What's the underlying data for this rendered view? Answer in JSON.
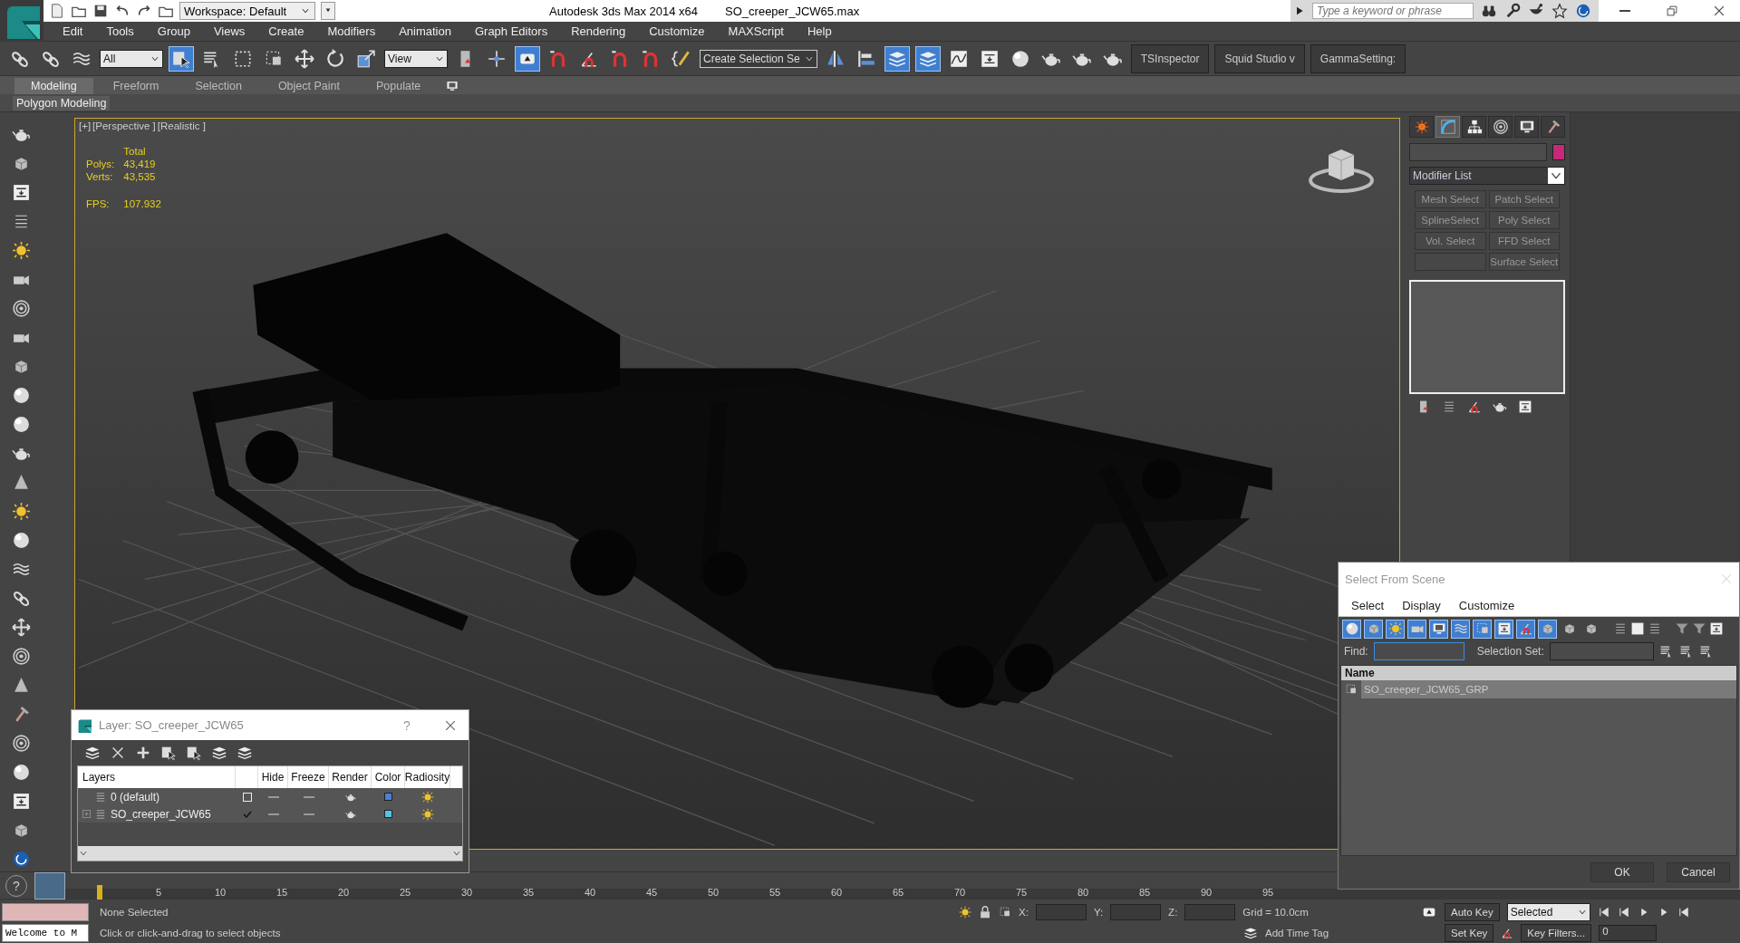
{
  "title_bar": {
    "workspace": "Workspace: Default",
    "app_title": "Autodesk 3ds Max  2014 x64",
    "file_name": "SO_creeper_JCW65.max",
    "search_placeholder": "Type a keyword or phrase"
  },
  "menu": [
    "Edit",
    "Tools",
    "Group",
    "Views",
    "Create",
    "Modifiers",
    "Animation",
    "Graph Editors",
    "Rendering",
    "Customize",
    "MAXScript",
    "Help"
  ],
  "main_toolbar": [
    {
      "kind": "icon",
      "on": false
    },
    {
      "kind": "icon",
      "on": false
    },
    {
      "kind": "icon",
      "on": false
    },
    {
      "kind": "dropdown",
      "value": "All"
    },
    {
      "kind": "icon",
      "on": true
    },
    {
      "kind": "icon",
      "on": false
    },
    {
      "kind": "icon",
      "on": false
    },
    {
      "kind": "icon",
      "on": false
    },
    {
      "kind": "icon",
      "on": false
    },
    {
      "kind": "icon",
      "on": false
    },
    {
      "kind": "icon",
      "on": false
    },
    {
      "kind": "dropdown",
      "value": "View"
    },
    {
      "kind": "icon",
      "on": false
    },
    {
      "kind": "icon",
      "on": false
    },
    {
      "kind": "icon",
      "on": true
    },
    {
      "kind": "icon",
      "on": false
    },
    {
      "kind": "icon",
      "on": false
    },
    {
      "kind": "icon",
      "on": false
    },
    {
      "kind": "icon",
      "on": false
    },
    {
      "kind": "icon",
      "on": false
    },
    {
      "kind": "dropdown",
      "value": "Create Selection Se"
    },
    {
      "kind": "icon",
      "on": false
    },
    {
      "kind": "icon",
      "on": false
    },
    {
      "kind": "icon",
      "on": true
    },
    {
      "kind": "icon",
      "on": true
    },
    {
      "kind": "icon",
      "on": false
    },
    {
      "kind": "icon",
      "on": false
    },
    {
      "kind": "icon",
      "on": false
    },
    {
      "kind": "icon",
      "on": false
    },
    {
      "kind": "icon",
      "on": false
    },
    {
      "kind": "icon",
      "on": false
    },
    {
      "kind": "text",
      "value": "TSInspector"
    },
    {
      "kind": "text",
      "value": "Squid Studio v"
    },
    {
      "kind": "text",
      "value": "GammaSetting:"
    }
  ],
  "ribbon_tabs": [
    {
      "label": "Modeling",
      "selected": true
    },
    {
      "label": "Freeform",
      "selected": false
    },
    {
      "label": "Selection",
      "selected": false
    },
    {
      "label": "Object Paint",
      "selected": false
    },
    {
      "label": "Populate",
      "selected": false
    }
  ],
  "ribbon_panel": "Polygon Modeling",
  "viewport": {
    "labels": [
      "[+]",
      "[Perspective ]",
      "[Realistic ]"
    ],
    "stats_header": "Total",
    "stats": [
      {
        "label": "Polys:",
        "value": "43,419"
      },
      {
        "label": "Verts:",
        "value": "43,535"
      }
    ],
    "fps_label": "FPS:",
    "fps": "107.932"
  },
  "command_panel": {
    "tabs": [
      {
        "selected": false
      },
      {
        "selected": true
      },
      {
        "selected": false
      },
      {
        "selected": false
      },
      {
        "selected": false
      },
      {
        "selected": false
      }
    ],
    "modifier_list": "Modifier List",
    "modifier_buttons": [
      {
        "kind": "button",
        "label": "Mesh Select"
      },
      {
        "kind": "button",
        "label": "Patch Select"
      },
      {
        "kind": "button",
        "label": "SplineSelect"
      },
      {
        "kind": "button",
        "label": "Poly Select"
      },
      {
        "kind": "button",
        "label": "Vol. Select"
      },
      {
        "kind": "button",
        "label": "FFD Select"
      },
      {
        "kind": "blank"
      },
      {
        "kind": "button",
        "label": "Surface Select"
      }
    ]
  },
  "select_from_scene": {
    "title": "Select From Scene",
    "menus": [
      "Select",
      "Display",
      "Customize"
    ],
    "filters": [
      {
        "on": true
      },
      {
        "on": true
      },
      {
        "on": true
      },
      {
        "on": true
      },
      {
        "on": true
      },
      {
        "on": true
      },
      {
        "on": true
      },
      {
        "on": true
      },
      {
        "on": true
      },
      {
        "on": true
      },
      {
        "on": false
      },
      {
        "on": false
      }
    ],
    "find_label": "Find:",
    "selection_set_label": "Selection Set:",
    "column": "Name",
    "rows": [
      {
        "name": "SO_creeper_JCW65_GRP",
        "selected": true
      }
    ],
    "buttons": [
      "OK",
      "Cancel"
    ]
  },
  "layer_dialog": {
    "title": "Layer: SO_creeper_JCW65",
    "help": "?",
    "columns": [
      "Layers",
      "Hide",
      "Freeze",
      "Render",
      "Color",
      "Radiosity"
    ],
    "rows": [
      {
        "name": "0 (default)",
        "current": false,
        "expandable": false,
        "color": "#4a80dc"
      },
      {
        "name": "SO_creeper_JCW65",
        "current": true,
        "expandable": true,
        "color": "#50c4ea"
      }
    ]
  },
  "timeline": {
    "help": "?",
    "ticks": [
      "5",
      "10",
      "15",
      "20",
      "25",
      "30",
      "35",
      "40",
      "45",
      "50",
      "55",
      "60",
      "65",
      "70",
      "75",
      "80",
      "85",
      "90",
      "95"
    ]
  },
  "status": {
    "listener": "Welcome to M",
    "selection": "None Selected",
    "prompt": "Click or click-and-drag to select objects",
    "coords": [
      "X:",
      "Y:",
      "Z:"
    ],
    "grid": "Grid = 10.0cm",
    "time_tag": "Add Time Tag"
  },
  "anim": {
    "auto_key": "Auto Key",
    "key_mode": "Selected",
    "set_key": "Set Key",
    "key_filters": "Key Filters...",
    "frame": "0"
  }
}
